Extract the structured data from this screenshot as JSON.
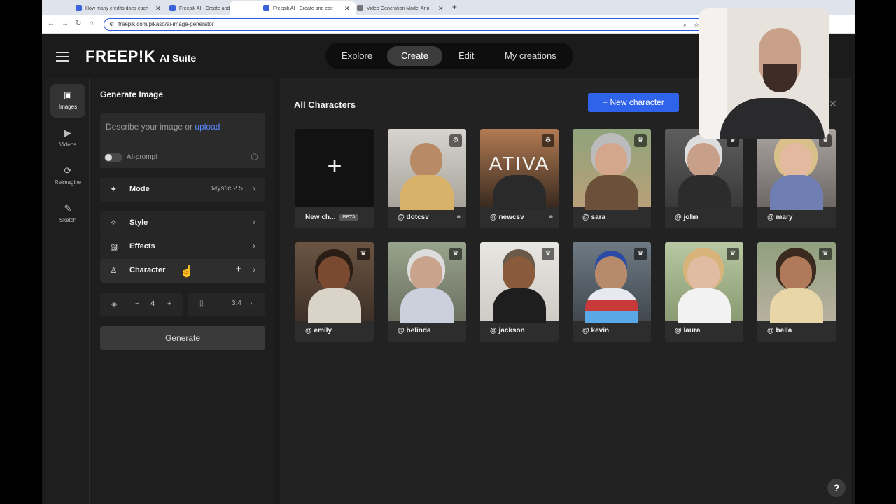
{
  "browser": {
    "tabs": [
      {
        "title": "How many credits does each"
      },
      {
        "title": "Freepik AI - Create and edit i"
      },
      {
        "title": "Freepik AI - Create and edit i"
      },
      {
        "title": "Video Generation Model Ann"
      }
    ],
    "url": "freepik.com/pikaso/ai-image-generator"
  },
  "header": {
    "logo": "FREEP!K",
    "suite": "AI Suite",
    "nav": [
      "Explore",
      "Create",
      "Edit",
      "My creations"
    ],
    "active_nav": "Create"
  },
  "rail": [
    {
      "label": "Images",
      "icon": "image-icon"
    },
    {
      "label": "Videos",
      "icon": "video-icon"
    },
    {
      "label": "Reimagine",
      "icon": "refresh-icon"
    },
    {
      "label": "Sketch",
      "icon": "brush-icon"
    }
  ],
  "panel": {
    "title": "Generate Image",
    "prompt_placeholder": "Describe your image or ",
    "upload_link": "upload",
    "ai_prompt_label": "AI-prompt",
    "mode_label": "Mode",
    "mode_value": "Mystic 2.5",
    "style_label": "Style",
    "effects_label": "Effects",
    "character_label": "Character",
    "count_minus": "−",
    "count_value": "4",
    "count_plus": "+",
    "ratio_value": "3:4",
    "generate_label": "Generate"
  },
  "main": {
    "title": "All Characters",
    "new_character_label": "New character",
    "new_card_label": "New ch...",
    "beta_label": "BETA",
    "characters": [
      {
        "name": "@ dotcsv",
        "locked": true
      },
      {
        "name": "@ newcsv",
        "locked": true
      },
      {
        "name": "@ sara"
      },
      {
        "name": "@ john"
      },
      {
        "name": "@ mary"
      },
      {
        "name": "@ emily"
      },
      {
        "name": "@ belinda"
      },
      {
        "name": "@ jackson"
      },
      {
        "name": "@ kevin"
      },
      {
        "name": "@ laura"
      },
      {
        "name": "@ bella"
      }
    ]
  },
  "help_label": "?",
  "colors": {
    "accent": "#2f63ea",
    "link": "#5a86ff",
    "background": "#1b1b1b"
  }
}
